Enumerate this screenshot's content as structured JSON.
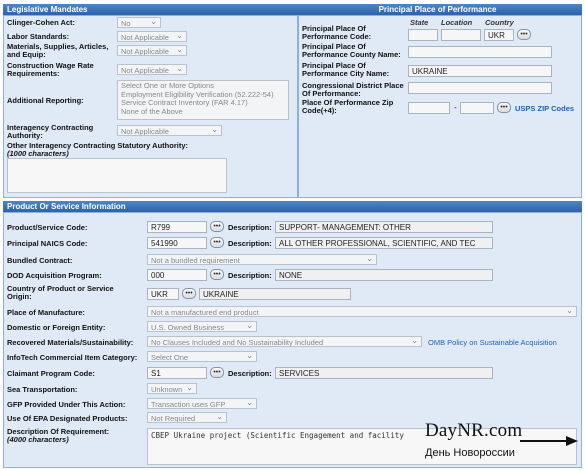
{
  "legislative": {
    "title": "Legislative Mandates",
    "clinger_label": "Clinger-Cohen Act:",
    "clinger_value": "No",
    "labor_label": "Labor Standards:",
    "labor_value": "Not Applicable",
    "materials_label": "Materials, Supplies, Articles, and Equip:",
    "materials_value": "Not Applicable",
    "construction_label": "Construction Wage Rate Requirements:",
    "construction_value": "Not Applicable",
    "additional_label": "Additional Reporting:",
    "additional_options": [
      "Select One or More Options",
      "Employment Eligibility Verification (52.222-54)",
      "Service Contract Inventory (FAR 4.17)",
      "None of the Above"
    ],
    "interagency_label": "Interagency Contracting Authority:",
    "interagency_value": "Not Applicable",
    "other_label": "Other Interagency Contracting Statutory Authority:",
    "other_note": "(1000 characters)"
  },
  "place": {
    "title": "Principal Place of Performance",
    "col_state": "State",
    "col_location": "Location",
    "col_country": "Country",
    "code_label": "Principal Place Of Performance Code:",
    "country_code": "UKR",
    "county_label": "Principal Place Of Performance County Name:",
    "city_label": "Principal Place Of Performance City Name:",
    "city_value": "UKRAINE",
    "district_label": "Congressional District Place Of Performance:",
    "zip_label": "Place Of Performance Zip Code(+4):",
    "zip_dash": "-",
    "zip_link": "USPS ZIP Codes"
  },
  "product": {
    "title": "Product Or Service Information",
    "psc_label": "Product/Service Code:",
    "psc_value": "R799",
    "psc_desc_label": "Description:",
    "psc_desc": "SUPPORT- MANAGEMENT: OTHER",
    "naics_label": "Principal NAICS Code:",
    "naics_value": "541990",
    "naics_desc_label": "Description:",
    "naics_desc": "ALL OTHER PROFESSIONAL, SCIENTIFIC, AND TEC",
    "bundled_label": "Bundled Contract:",
    "bundled_value": "Not a bundled requirement",
    "dod_label": "DOD Acquisition Program:",
    "dod_value": "000",
    "dod_desc_label": "Description:",
    "dod_desc": "NONE",
    "origin_label": "Country of Product or Service Origin:",
    "origin_code": "UKR",
    "origin_name": "UKRAINE",
    "manufacture_label": "Place of Manufacture:",
    "manufacture_value": "Not a manufactured end product",
    "domestic_label": "Domestic or Foreign Entity:",
    "domestic_value": "U.S. Owned Business",
    "recovered_label": "Recovered Materials/Sustainability:",
    "recovered_value": "No Clauses Included and No Sustainability Included",
    "omb_link": "OMB Policy on Sustainable Acquisition",
    "infotech_label": "InfoTech Commercial Item Category:",
    "infotech_value": "Select One",
    "claimant_label": "Claimant Program Code:",
    "claimant_value": "S1",
    "claimant_desc_label": "Description:",
    "claimant_desc": "SERVICES",
    "sea_label": "Sea Transportation:",
    "sea_value": "Unknown",
    "gfp_label": "GFP Provided Under This Action:",
    "gfp_value": "Transaction uses GFP",
    "epa_label": "Use Of EPA Designated Products:",
    "epa_value": "Not Required",
    "desc_req_label": "Description Of Requirement:",
    "desc_req_note": "(4000 characters)",
    "desc_req_value": "CBEP Ukraine project (Scientific Engagement and facility"
  },
  "watermark": {
    "site": "DayNR.com",
    "tagline": "День Новороссии"
  },
  "icons": {
    "lookup": "ellipsis-button",
    "arrow": "arrow-right-icon"
  },
  "colors": {
    "header": "#2c62a8",
    "panel": "#dfeaf6",
    "link": "#1f5fb8"
  }
}
